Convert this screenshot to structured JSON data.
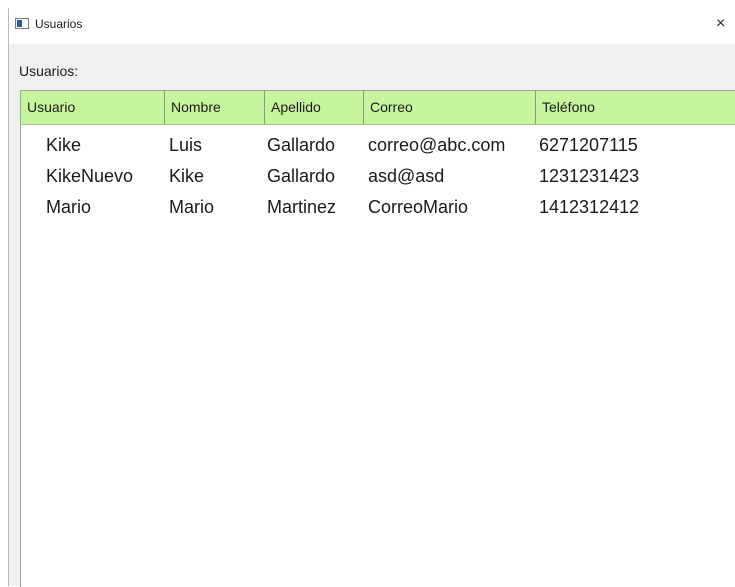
{
  "window": {
    "title": "Usuarios",
    "close_glyph": "×",
    "icon": "window-app-icon"
  },
  "main": {
    "label": "Usuarios:"
  },
  "table": {
    "header_color": "#c6f59e",
    "columns": [
      "Usuario",
      "Nombre",
      "Apellido",
      "Correo",
      "Teléfono"
    ],
    "rows": [
      [
        "Kike",
        "Luis",
        "Gallardo",
        "correo@abc.com",
        "6271207115"
      ],
      [
        "KikeNuevo",
        "Kike",
        "Gallardo",
        "asd@asd",
        "1231231423"
      ],
      [
        "Mario",
        "Mario",
        "Martinez",
        "CorreoMario",
        "1412312412"
      ]
    ]
  }
}
